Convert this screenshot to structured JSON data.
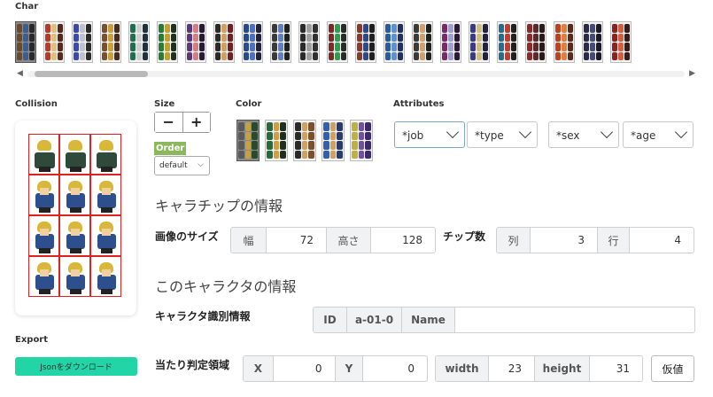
{
  "labels": {
    "char": "Char",
    "collision": "Collision",
    "size": "Size",
    "color": "Color",
    "attributes": "Attributes",
    "export": "Export",
    "order": "Order"
  },
  "size_controls": {
    "minus": "−",
    "plus": "+"
  },
  "order_select": {
    "value": "default"
  },
  "attributes": [
    "*job",
    "*type",
    "*sex",
    "*age"
  ],
  "chip_info": {
    "heading": "キャラチップの情報",
    "image_size_label": "画像のサイズ",
    "width_label": "幅",
    "width_value": "72",
    "height_label": "高さ",
    "height_value": "128",
    "chip_count_label": "チップ数",
    "cols_label": "列",
    "cols_value": "3",
    "rows_label": "行",
    "rows_value": "4"
  },
  "char_info": {
    "heading": "このキャラクタの情報",
    "id_label_text": "キャラクタ識別情報",
    "id_label": "ID",
    "id_value": "a-01-0",
    "name_label": "Name",
    "name_value": "",
    "hit_label": "当たり判定領域",
    "x_label": "X",
    "x_value": "0",
    "y_label": "Y",
    "y_value": "0",
    "w_label": "width",
    "w_value": "23",
    "h_label": "height",
    "h_value": "31",
    "provisional_button": "仮値"
  },
  "export_button": "Jsonをダウンロード",
  "scrollbar": {
    "left_arrow": "◀",
    "right_arrow": "▶"
  },
  "colors": {
    "accent": "#22d5a6",
    "order_badge": "#8bb85c",
    "collision_grid": "#e02020"
  }
}
